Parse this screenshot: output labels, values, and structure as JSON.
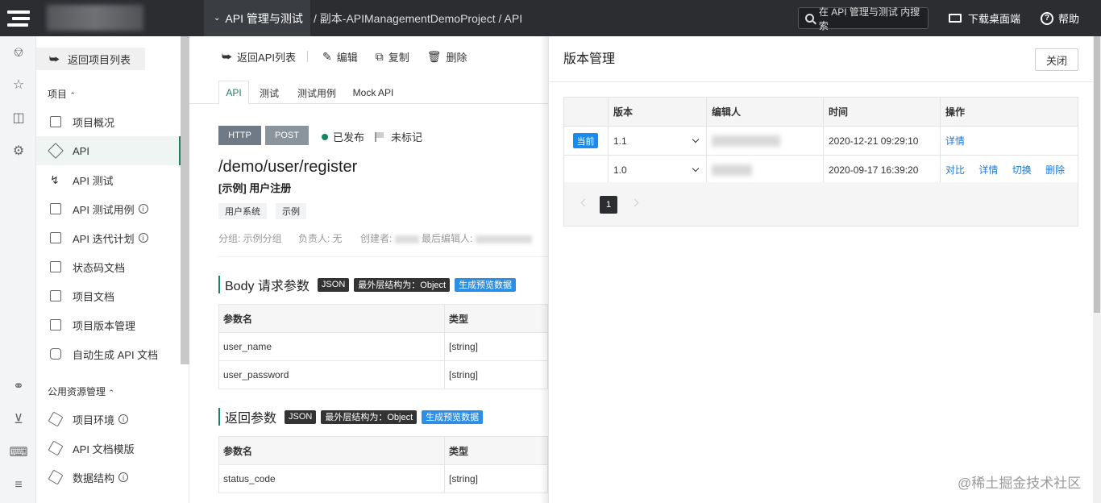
{
  "header": {
    "crumb_main": "API 管理与测试",
    "crumb_rest": "/ 副本-APIManagementDemoProject / API",
    "search_placeholder": "在 API 管理与测试 内搜索",
    "download_label": "下载桌面端",
    "help_label": "帮助"
  },
  "sidebar": {
    "back_label": "返回项目列表",
    "section1": "项目",
    "section2": "公用资源管理",
    "items": [
      {
        "label": "项目概况"
      },
      {
        "label": "API"
      },
      {
        "label": "API 测试"
      },
      {
        "label": "API 测试用例"
      },
      {
        "label": "API 迭代计划"
      },
      {
        "label": "状态码文档"
      },
      {
        "label": "项目文档"
      },
      {
        "label": "项目版本管理"
      },
      {
        "label": "自动生成 API 文档"
      }
    ],
    "public_items": [
      {
        "label": "项目环境"
      },
      {
        "label": "API 文档模版"
      },
      {
        "label": "数据结构"
      }
    ]
  },
  "toolbar": {
    "back": "返回API列表",
    "edit": "编辑",
    "copy": "复制",
    "delete": "删除"
  },
  "tabs": [
    "API",
    "测试",
    "测试用例",
    "Mock API"
  ],
  "api": {
    "protocol": "HTTP",
    "method": "POST",
    "status": "已发布",
    "mark": "未标记",
    "path": "/demo/user/register",
    "name": "[示例] 用户注册",
    "tags": [
      "用户系统",
      "示例"
    ],
    "meta_group": "分组: 示例分组",
    "meta_owner": "负责人: 无",
    "meta_creator": "创建者:",
    "meta_editor": "最后编辑人:"
  },
  "body_params": {
    "title": "Body 请求参数",
    "chip_json": "JSON",
    "chip_struct": "最外层结构为：Object",
    "chip_preview": "生成预览数据",
    "col_name": "参数名",
    "col_type": "类型",
    "rows": [
      {
        "name": "user_name",
        "type": "[string]"
      },
      {
        "name": "user_password",
        "type": "[string]"
      }
    ]
  },
  "return_params": {
    "title": "返回参数",
    "chip_json": "JSON",
    "chip_struct": "最外层结构为：Object",
    "chip_preview": "生成预览数据",
    "col_name": "参数名",
    "col_type": "类型",
    "rows": [
      {
        "name": "status_code",
        "type": "[string]"
      }
    ]
  },
  "version_panel": {
    "title": "版本管理",
    "close_label": "关闭",
    "headers": {
      "version": "版本",
      "editor": "编辑人",
      "time": "时间",
      "ops": "操作"
    },
    "current_badge": "当前",
    "rows": [
      {
        "version": "1.1",
        "time": "2020-12-21 09:29:10",
        "ops": [
          "详情"
        ]
      },
      {
        "version": "1.0",
        "time": "2020-09-17 16:39:20",
        "ops": [
          "对比",
          "详情",
          "切换",
          "删除"
        ]
      }
    ],
    "page": "1"
  },
  "watermark": "@稀土掘金技术社区"
}
